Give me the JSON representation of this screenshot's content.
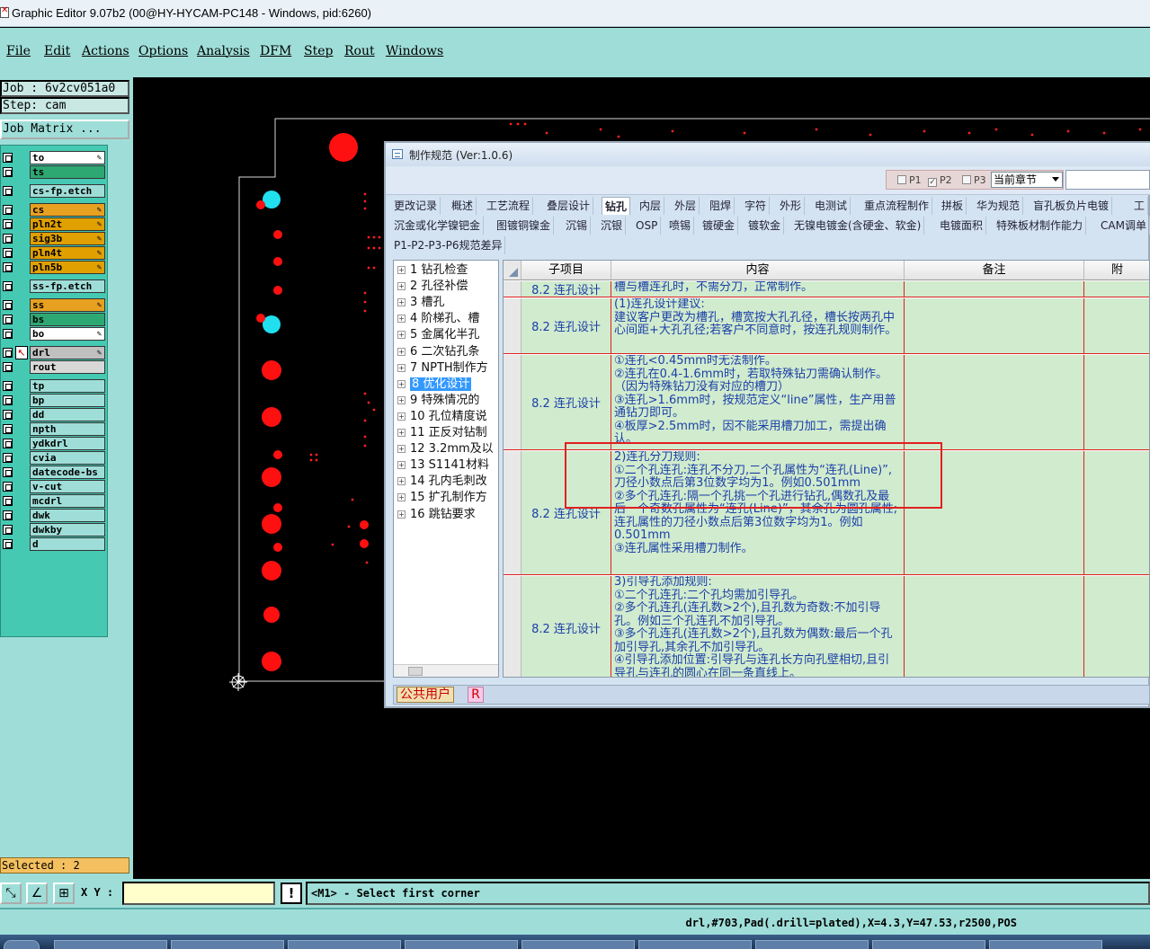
{
  "window": {
    "title": "Graphic Editor 9.07b2 (00@HY-HYCAM-PC148 - Windows, pid:6260)"
  },
  "menu": [
    "File",
    "Edit",
    "Actions",
    "Options",
    "Analysis",
    "DFM",
    "Step",
    "Rout",
    "Windows"
  ],
  "job": {
    "job_line": "Job : 6v2cv051a0",
    "step_line": "Step: cam",
    "matrix_button": "Job Matrix ..."
  },
  "layers": [
    {
      "name": "to",
      "color": "#ffffff",
      "editable": true
    },
    {
      "name": "ts",
      "color": "#2ea873",
      "editable": false
    },
    {
      "name": "cs-fp.etch",
      "color": "#9fded8",
      "editable": false
    },
    {
      "name": "cs",
      "color": "#e8a020",
      "editable": true
    },
    {
      "name": "pln2t",
      "color": "#e0a000",
      "editable": true
    },
    {
      "name": "sig3b",
      "color": "#e0a000",
      "editable": true
    },
    {
      "name": "pln4t",
      "color": "#e0a000",
      "editable": true
    },
    {
      "name": "pln5b",
      "color": "#e0a000",
      "editable": true
    },
    {
      "name": "ss-fp.etch",
      "color": "#9fded8",
      "editable": false
    },
    {
      "name": "ss",
      "color": "#e8a020",
      "editable": true
    },
    {
      "name": "bs",
      "color": "#2ea873",
      "editable": false
    },
    {
      "name": "bo",
      "color": "#ffffff",
      "editable": true
    },
    {
      "name": "drl",
      "color": "#c0c0c0",
      "editable": true,
      "active": true
    },
    {
      "name": "rout",
      "color": "#d8d8d8",
      "editable": false
    },
    {
      "name": "tp",
      "color": "#9fded8",
      "editable": false
    },
    {
      "name": "bp",
      "color": "#9fded8",
      "editable": false
    },
    {
      "name": "dd",
      "color": "#9fded8",
      "editable": false
    },
    {
      "name": "npth",
      "color": "#9fded8",
      "editable": false
    },
    {
      "name": "ydkdrl",
      "color": "#9fded8",
      "editable": false
    },
    {
      "name": "cvia",
      "color": "#9fded8",
      "editable": false
    },
    {
      "name": "datecode-bs",
      "color": "#9fded8",
      "editable": false
    },
    {
      "name": "v-cut",
      "color": "#9fded8",
      "editable": false
    },
    {
      "name": "mcdrl",
      "color": "#9fded8",
      "editable": false
    },
    {
      "name": "dwk",
      "color": "#9fded8",
      "editable": false
    },
    {
      "name": "dwkby",
      "color": "#9fded8",
      "editable": false
    },
    {
      "name": "d",
      "color": "#9fded8",
      "editable": false
    }
  ],
  "selected": "Selected : 2",
  "coords": {
    "label": "X Y :",
    "value": ""
  },
  "prompt": "<M1> - Select first corner",
  "status": "drl,#703,Pad(.drill=plated),X=4.3,Y=47.53,r2500,POS",
  "dialog": {
    "title": "制作规范 (Ver:1.0.6)",
    "checks": [
      {
        "label": "P1",
        "checked": false
      },
      {
        "label": "P2",
        "checked": true
      },
      {
        "label": "P3",
        "checked": false
      }
    ],
    "chapter_select": "当前章节",
    "tabs_row1": [
      "更改记录",
      "概述",
      "工艺流程",
      "叠层设计",
      "钻孔",
      "内层",
      "外层",
      "阻焊",
      "字符",
      "外形",
      "电测试",
      "重点流程制作",
      "拼板",
      "华为规范",
      "盲孔板负片电镀",
      "工"
    ],
    "tabs_row2": [
      "沉金或化学镍钯金",
      "图镀铜镍金",
      "沉锡",
      "沉银",
      "OSP",
      "喷锡",
      "镀硬金",
      "镀软金",
      "无镍电镀金(含硬金、软金)",
      "电镀面积",
      "特殊板材制作能力",
      "CAM调单"
    ],
    "tabs_row3": [
      "P1-P2-P3-P6规范差异"
    ],
    "active_tab": "钻孔",
    "tree": [
      {
        "label": "1 钻孔检查"
      },
      {
        "label": "2 孔径补偿"
      },
      {
        "label": "3 槽孔"
      },
      {
        "label": "4 阶梯孔、槽"
      },
      {
        "label": "5 金属化半孔"
      },
      {
        "label": "6 二次钻孔条"
      },
      {
        "label": "7 NPTH制作方"
      },
      {
        "label": "8 优化设计",
        "selected": true
      },
      {
        "label": "9 特殊情况的"
      },
      {
        "label": "10 孔位精度说"
      },
      {
        "label": "11 正反对钻制"
      },
      {
        "label": "12 3.2mm及以"
      },
      {
        "label": "13 S1141材料"
      },
      {
        "label": "14 孔内毛刺改"
      },
      {
        "label": "15 扩孔制作方"
      },
      {
        "label": "16 跳钻要求"
      }
    ],
    "columns": [
      "子项目",
      "内容",
      "备注",
      "附"
    ],
    "rows": [
      {
        "item": "8.2 连孔设计",
        "content": "槽与槽连孔时，不需分刀，正常制作。"
      },
      {
        "item": "8.2 连孔设计",
        "content": " (1)连孔设计建议:\n建议客户更改为槽孔，槽宽按大孔孔径，槽长按两孔中心间距+大孔孔径;若客户不同意时，按连孔规则制作。"
      },
      {
        "item": "8.2 连孔设计",
        "content": "①连孔<0.45mm时无法制作。\n②连孔在0.4-1.6mm时，若取特殊钻刀需确认制作。（因为特殊钻刀没有对应的槽刀）\n③连孔>1.6mm时，按规范定义“line”属性，生产用普通钻刀即可。\n④板厚>2.5mm时，因不能采用槽刀加工，需提出确认。"
      },
      {
        "item": "8.2 连孔设计",
        "content": "2)连孔分刀规则:\n①二个孔连孔:连孔不分刀,二个孔属性为“连孔(Line)”,刀径小数点后第3位数字均为1。例如0.501mm\n②多个孔连孔:隔一个孔挑一个孔进行钻孔,偶数孔及最后一个奇数孔属性为“连孔(Line)”，其余孔为圆孔属性;连孔属性的刀径小数点后第3位数字均为1。例如0.501mm\n③连孔属性采用槽刀制作。"
      },
      {
        "item": "8.2 连孔设计",
        "content": "3)引导孔添加规则:\n①二个孔连孔:二个孔均需加引导孔。\n②多个孔连孔(连孔数>2个),且孔数为奇数:不加引导孔。例如三个孔连孔不加引导孔。\n③多个孔连孔(连孔数>2个),且孔数为偶数:最后一个孔加引导孔,其余孔不加引导孔。\n④引导孔添加位置:引导孔与连孔长方向孔壁相切,且引导孔与连孔的圆心在同一条直线上。"
      }
    ],
    "footer_user": "公共用户",
    "footer_r": "R"
  }
}
